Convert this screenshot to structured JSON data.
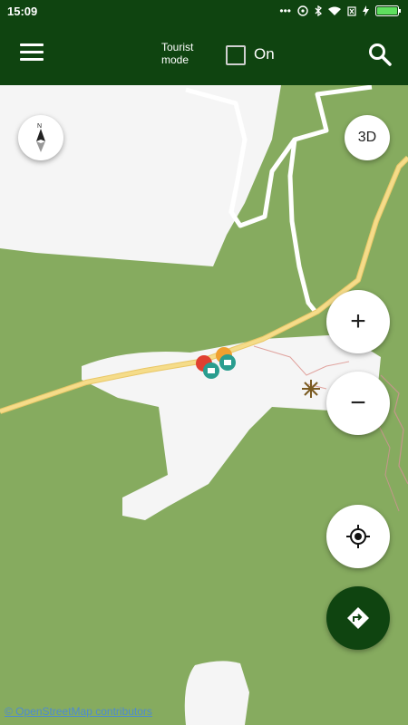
{
  "status_bar": {
    "time": "15:09",
    "icons": [
      "more-icon",
      "hotspot-icon",
      "bluetooth-icon",
      "wifi-icon",
      "sim-icon",
      "charging-icon",
      "battery-icon"
    ]
  },
  "app_bar": {
    "tourist_mode_label": "Tourist mode",
    "toggle_label": "On",
    "toggle_checked": false,
    "icons": [
      "menu-icon",
      "search-icon"
    ]
  },
  "map": {
    "buttons": {
      "three_d": "3D",
      "zoom_in": "+",
      "zoom_out": "−"
    },
    "attribution": "© OpenStreetMap contributors",
    "colors": {
      "forest": "#86ab5f",
      "settlement": "#f5f5f5",
      "road": "#f0d57b",
      "appbar": "#0f4410"
    }
  }
}
